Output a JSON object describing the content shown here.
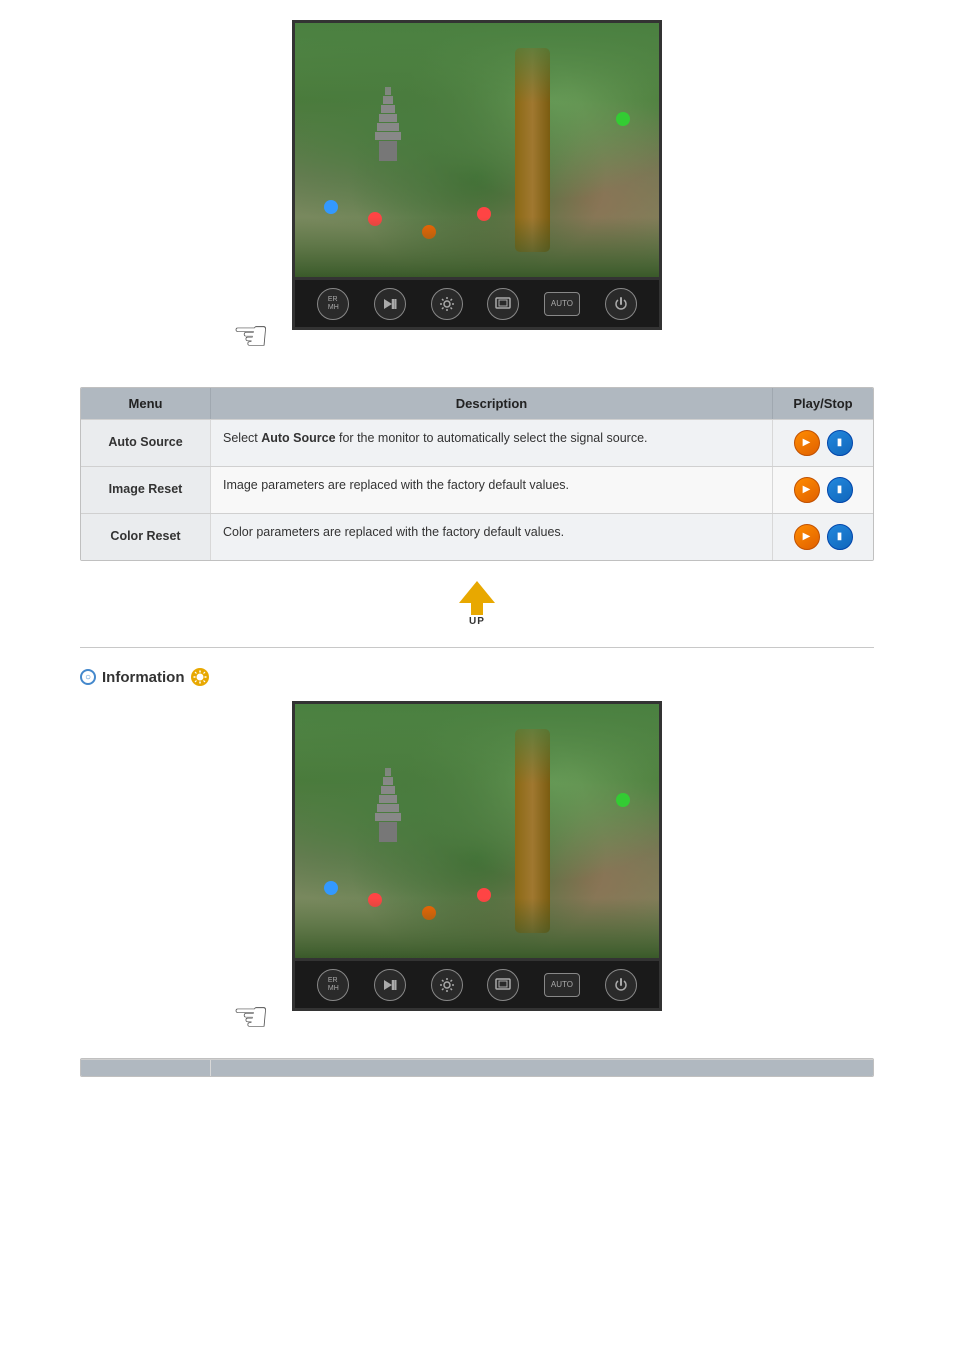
{
  "table": {
    "headers": {
      "menu": "Menu",
      "description": "Description",
      "playstop": "Play/Stop"
    },
    "rows": [
      {
        "menu": "Auto Source",
        "description_prefix": "Select ",
        "description_bold": "Auto Source",
        "description_suffix": " for the monitor to automatically select the signal source."
      },
      {
        "menu": "Image Reset",
        "description": "Image parameters are replaced with the factory default values."
      },
      {
        "menu": "Color Reset",
        "description": "Color parameters are replaced with the factory default values."
      }
    ]
  },
  "info": {
    "title": "Information"
  },
  "controls": {
    "btn1": "ER\nMH",
    "btn2": "⚙",
    "btn3": "A⚙",
    "btn4": "▣",
    "btn5": "AUTO",
    "btn6": "⏻"
  },
  "up_label": "UP",
  "bottom_table": {
    "col1": "",
    "col2": ""
  }
}
